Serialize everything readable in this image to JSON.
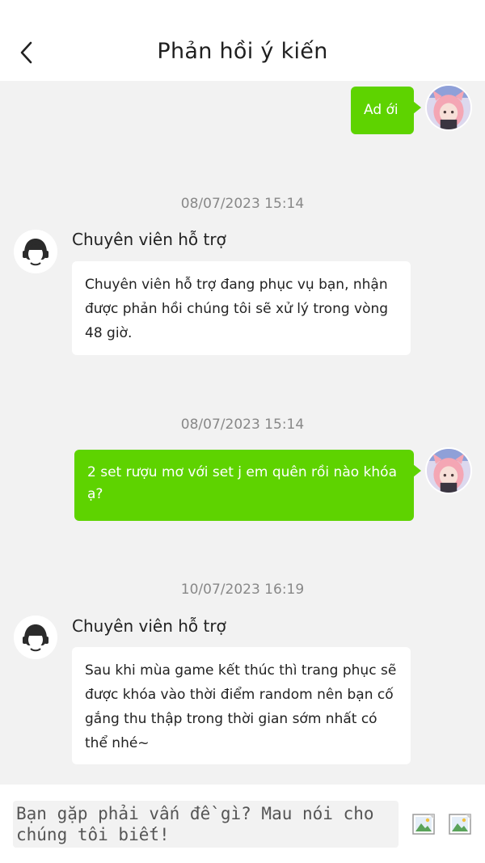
{
  "header": {
    "title": "Phản hồi ý kiến",
    "back_icon": "chevron-left-icon"
  },
  "messages": [
    {
      "sender": "user",
      "text": "Ad ới"
    },
    {
      "timestamp": "08/07/2023 15:14",
      "sender": "support",
      "sender_name": "Chuyên viên hỗ trợ",
      "text": "Chuyên viên hỗ trợ đang phục vụ bạn, nhận được phản hồi chúng tôi sẽ xử lý trong vòng 48 giờ."
    },
    {
      "timestamp": "08/07/2023 15:14",
      "sender": "user",
      "text": "2 set rượu mơ với set j em quên rồi nào khóa ạ?"
    },
    {
      "timestamp": "10/07/2023 16:19",
      "sender": "support",
      "sender_name": "Chuyên viên hỗ trợ",
      "text": "Sau khi mùa game kết thúc thì trang phục sẽ được khóa vào thời điểm random nên bạn cố gắng thu thập trong thời gian sớm nhất có thể nhé~"
    }
  ],
  "composer": {
    "placeholder": "Bạn gặp phải vấn đề gì? Mau nói cho chúng tôi biết!",
    "image_button_icon": "broken-image-icon",
    "attach_button_icon": "broken-image-icon"
  },
  "colors": {
    "user_bubble": "#5ed300",
    "background": "#f2f2f2",
    "timestamp": "#888888"
  }
}
